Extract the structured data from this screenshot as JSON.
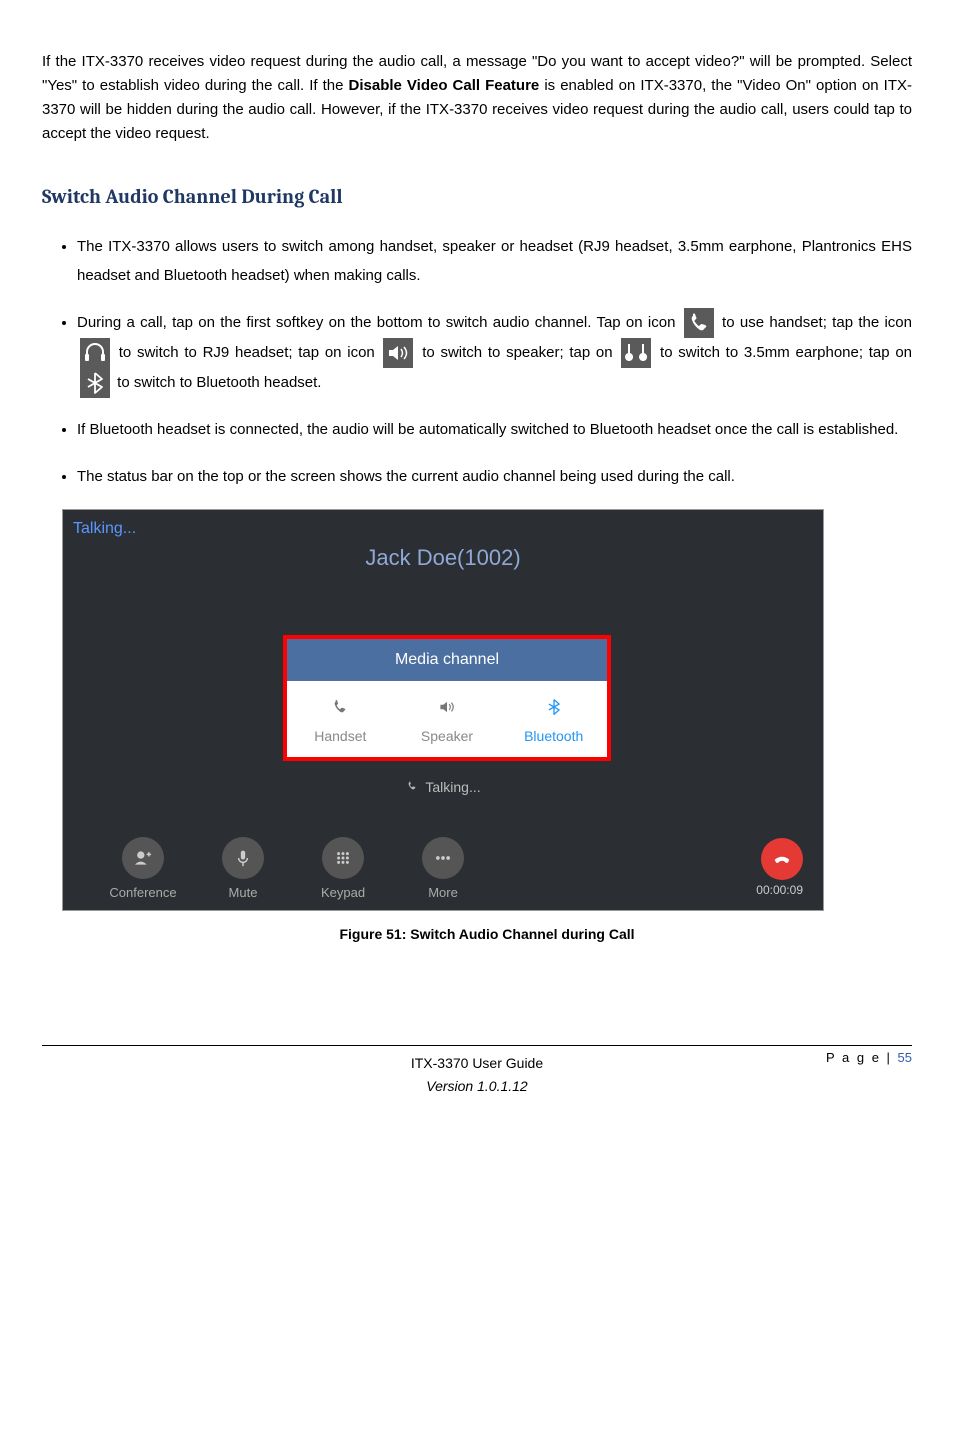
{
  "intro": {
    "t1": "If the ITX-3370 receives video request during the audio call, a message \"Do you want to accept video?\" will be prompted. Select \"Yes\" to establish video during the call. If the ",
    "bold": "Disable Video Call Feature",
    "t2": " is enabled on ITX-3370, the \"Video On\" option on ITX-3370 will be hidden during the audio call. However, if the ITX-3370 receives video request during the audio call, users could tap to accept the video request."
  },
  "heading": "Switch Audio Channel During Call",
  "bullets": {
    "b1": "The ITX-3370 allows users to switch among handset, speaker or headset (RJ9 headset, 3.5mm earphone, Plantronics EHS headset and Bluetooth headset) when making calls.",
    "b2a": "During a call, tap on the first softkey on the bottom to switch audio channel. Tap on icon ",
    "b2b": " to use handset; tap the icon ",
    "b2c": " to switch to RJ9 headset; tap on icon ",
    "b2d": " to switch to speaker; tap on ",
    "b2e": " to switch to 3.5mm earphone; tap on ",
    "b2f": " to switch to Bluetooth headset.",
    "b3": "If Bluetooth headset is connected, the audio will be automatically switched to Bluetooth headset once the call is established.",
    "b4": "The status bar on the top or the screen shows the current audio channel being used during the call."
  },
  "figure": {
    "caption": "Figure 51: Switch Audio Channel during Call",
    "talking": "Talking...",
    "caller": "Jack Doe(1002)",
    "mediaTitle": "Media channel",
    "handset": "Handset",
    "speaker": "Speaker",
    "bluetooth": "Bluetooth",
    "subTalking": "Talking...",
    "conf": "Conference",
    "mute": "Mute",
    "keypad": "Keypad",
    "more": "More",
    "timer": "00:00:09"
  },
  "footer": {
    "pageLabel": "P a g e | ",
    "pageNum": "55",
    "title": "ITX-3370 User Guide",
    "version": "Version 1.0.1.12"
  }
}
